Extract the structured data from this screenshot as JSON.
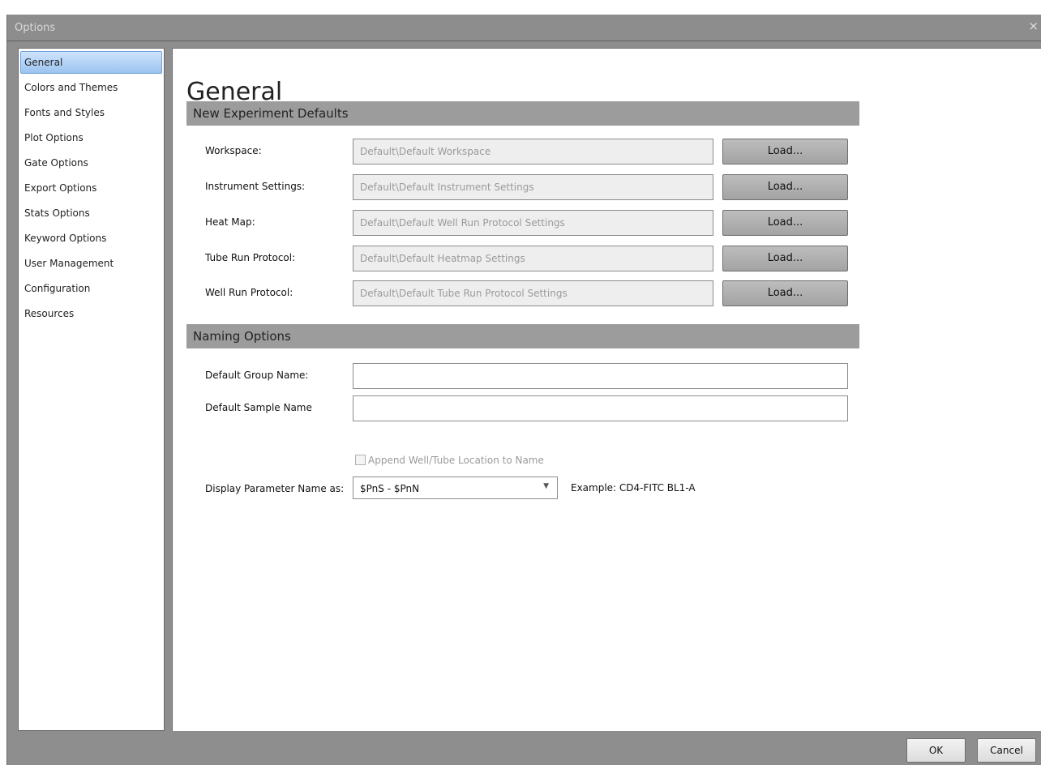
{
  "window": {
    "title": "Options",
    "close_glyph": "×"
  },
  "sidebar": {
    "items": [
      {
        "label": "General",
        "active": true
      },
      {
        "label": "Colors and Themes"
      },
      {
        "label": "Fonts and Styles"
      },
      {
        "label": "Plot Options"
      },
      {
        "label": "Gate Options"
      },
      {
        "label": "Export Options"
      },
      {
        "label": "Stats Options"
      },
      {
        "label": "Keyword Options"
      },
      {
        "label": "User Management"
      },
      {
        "label": "Configuration"
      },
      {
        "label": "Resources"
      }
    ]
  },
  "main": {
    "title": "General",
    "experiment_defaults": {
      "header": "New Experiment Defaults",
      "load_label": "Load...",
      "rows": [
        {
          "label": "Workspace:",
          "value": "Default\\Default Workspace"
        },
        {
          "label": "Instrument Settings:",
          "value": "Default\\Default Instrument Settings"
        },
        {
          "label": "Heat Map:",
          "value": "Default\\Default Well Run Protocol Settings"
        },
        {
          "label": "Tube Run Protocol:",
          "value": "Default\\Default Heatmap Settings"
        },
        {
          "label": "Well Run Protocol:",
          "value": "Default\\Default Tube Run Protocol Settings"
        }
      ]
    },
    "naming": {
      "header": "Naming Options",
      "group_name_label": "Default Group Name:",
      "group_name_value": "",
      "sample_name_label": "Default Sample Name",
      "sample_name_value": "",
      "append_label": "Append Well/Tube Location to Name",
      "append_checked": false,
      "display_param_label": "Display Parameter Name as:",
      "display_param_value": "$PnS - $PnN",
      "example_text": "Example: CD4-FITC BL1-A"
    }
  },
  "footer": {
    "ok_label": "OK",
    "cancel_label": "Cancel"
  },
  "colors": {
    "chrome": "#8e8e8e",
    "section_header": "#9c9c9c",
    "active_nav": "#9cc4f1"
  }
}
